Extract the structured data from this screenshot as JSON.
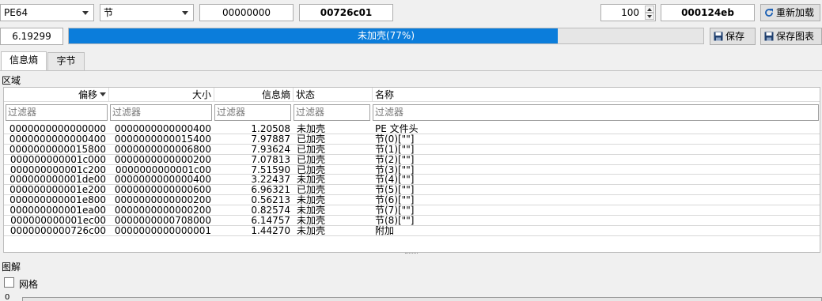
{
  "toolbar": {
    "type_select": "PE64",
    "section_select": "节",
    "offset_field": "00000000",
    "address_field": "00726c01",
    "block_size": "100",
    "size_field": "000124eb",
    "reload_label": "重新加载"
  },
  "entropy": {
    "value": "6.19299",
    "progress_text": "未加壳(77%)",
    "progress_percent": 77,
    "save_label": "保存",
    "save_chart_label": "保存图表"
  },
  "tabs": [
    "信息熵",
    "字节"
  ],
  "regions": {
    "label": "区域",
    "headers": [
      "偏移",
      "大小",
      "信息熵",
      "状态",
      "名称"
    ],
    "filter_placeholder": "过滤器",
    "rows": [
      [
        "0000000000000000",
        "0000000000000400",
        "1.20508",
        "未加壳",
        "PE 文件头"
      ],
      [
        "0000000000000400",
        "0000000000015400",
        "7.97887",
        "已加壳",
        "节(0)[\"\"]"
      ],
      [
        "0000000000015800",
        "0000000000006800",
        "7.93624",
        "已加壳",
        "节(1)[\"\"]"
      ],
      [
        "000000000001c000",
        "0000000000000200",
        "7.07813",
        "已加壳",
        "节(2)[\"\"]"
      ],
      [
        "000000000001c200",
        "0000000000001c00",
        "7.51590",
        "已加壳",
        "节(3)[\"\"]"
      ],
      [
        "000000000001de00",
        "0000000000000400",
        "3.22437",
        "未加壳",
        "节(4)[\"\"]"
      ],
      [
        "000000000001e200",
        "0000000000000600",
        "6.96321",
        "已加壳",
        "节(5)[\"\"]"
      ],
      [
        "000000000001e800",
        "0000000000000200",
        "0.56213",
        "未加壳",
        "节(6)[\"\"]"
      ],
      [
        "000000000001ea00",
        "0000000000000200",
        "0.82574",
        "未加壳",
        "节(7)[\"\"]"
      ],
      [
        "000000000001ec00",
        "0000000000708000",
        "6.14757",
        "未加壳",
        "节(8)[\"\"]"
      ],
      [
        "0000000000726c00",
        "0000000000000001",
        "1.44270",
        "未加壳",
        "附加"
      ]
    ]
  },
  "chart": {
    "label": "图解",
    "grid_label": "网格",
    "axis_start": "0"
  },
  "colors": {
    "progress": "#0b7ddb"
  }
}
